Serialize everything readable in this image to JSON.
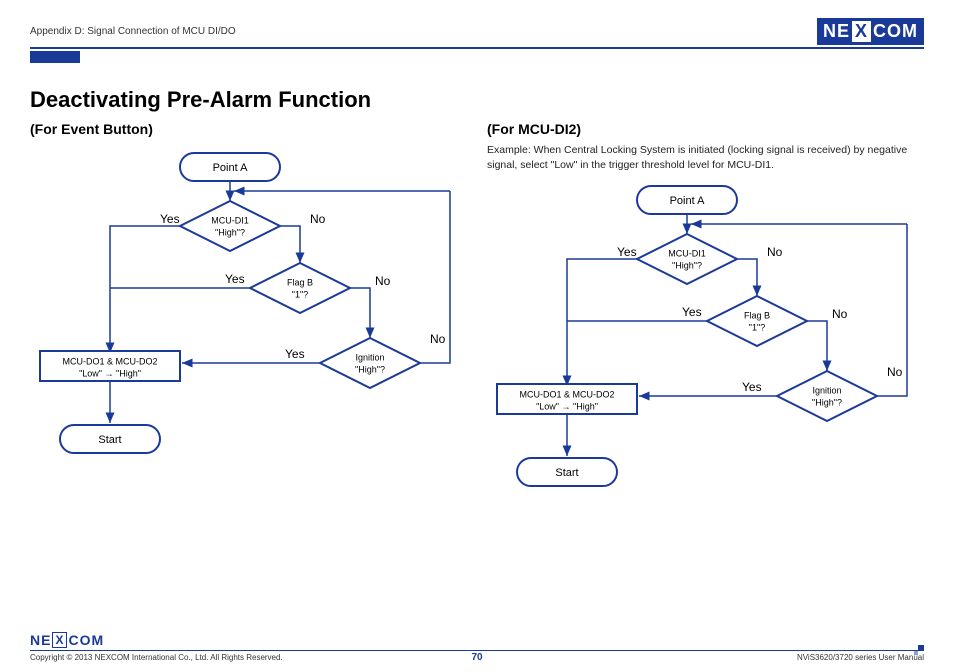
{
  "header": {
    "appendix": "Appendix D: Signal Connection of MCU DI/DO",
    "logo_left": "NE",
    "logo_mid": "X",
    "logo_right": "COM"
  },
  "title": "Deactivating Pre-Alarm Function",
  "left": {
    "subhead": "(For Event Button)",
    "nodes": {
      "pointA": "Point A",
      "di1_l1": "MCU-DI1",
      "di1_l2": "\"High\"?",
      "flag_l1": "Flag B",
      "flag_l2": "\"1\"?",
      "ign_l1": "Ignition",
      "ign_l2": "\"High\"?",
      "do_l1": "MCU-DO1 & MCU-DO2",
      "do_l2": "\"Low\" → \"High\"",
      "start": "Start"
    },
    "labels": {
      "yes1": "Yes",
      "no1": "No",
      "yes2": "Yes",
      "no2": "No",
      "yes3": "Yes",
      "no3": "No"
    }
  },
  "right": {
    "subhead": "(For MCU-DI2)",
    "example": "Example: When Central Locking System is initiated (locking signal is received) by negative signal, select \"Low\" in the trigger threshold level for MCU-DI1.",
    "nodes": {
      "pointA": "Point A",
      "di1_l1": "MCU-DI1",
      "di1_l2": "\"High\"?",
      "flag_l1": "Flag B",
      "flag_l2": "\"1\"?",
      "ign_l1": "Ignition",
      "ign_l2": "\"High\"?",
      "do_l1": "MCU-DO1 & MCU-DO2",
      "do_l2": "\"Low\" → \"High\"",
      "start": "Start"
    },
    "labels": {
      "yes1": "Yes",
      "no1": "No",
      "yes2": "Yes",
      "no2": "No",
      "yes3": "Yes",
      "no3": "No"
    }
  },
  "footer": {
    "copyright": "Copyright © 2013 NEXCOM International Co., Ltd. All Rights Reserved.",
    "page": "70",
    "doc": "NViS3620/3720 series User Manual"
  },
  "chart_data": [
    {
      "type": "flowchart",
      "title": "Deactivating Pre-Alarm Function (For Event Button)",
      "nodes": [
        {
          "id": "pointA",
          "shape": "terminator",
          "text": "Point A"
        },
        {
          "id": "d1",
          "shape": "decision",
          "text": "MCU-DI1 \"High\"?"
        },
        {
          "id": "d2",
          "shape": "decision",
          "text": "Flag B \"1\"?"
        },
        {
          "id": "d3",
          "shape": "decision",
          "text": "Ignition \"High\"?"
        },
        {
          "id": "p1",
          "shape": "process",
          "text": "MCU-DO1 & MCU-DO2 \"Low\" → \"High\""
        },
        {
          "id": "start",
          "shape": "terminator",
          "text": "Start"
        }
      ],
      "edges": [
        {
          "from": "pointA",
          "to": "d1"
        },
        {
          "from": "d1",
          "to": "p1",
          "label": "Yes"
        },
        {
          "from": "d1",
          "to": "d2",
          "label": "No"
        },
        {
          "from": "d2",
          "to": "p1",
          "label": "Yes"
        },
        {
          "from": "d2",
          "to": "d3",
          "label": "No"
        },
        {
          "from": "d3",
          "to": "p1",
          "label": "Yes"
        },
        {
          "from": "d3",
          "to": "pointA",
          "label": "No"
        },
        {
          "from": "p1",
          "to": "start"
        }
      ]
    },
    {
      "type": "flowchart",
      "title": "Deactivating Pre-Alarm Function (For MCU-DI2)",
      "note": "Example: When Central Locking System is initiated (locking signal is received) by negative signal, select \"Low\" in the trigger threshold level for MCU-DI1.",
      "nodes": [
        {
          "id": "pointA",
          "shape": "terminator",
          "text": "Point A"
        },
        {
          "id": "d1",
          "shape": "decision",
          "text": "MCU-DI1 \"High\"?"
        },
        {
          "id": "d2",
          "shape": "decision",
          "text": "Flag B \"1\"?"
        },
        {
          "id": "d3",
          "shape": "decision",
          "text": "Ignition \"High\"?"
        },
        {
          "id": "p1",
          "shape": "process",
          "text": "MCU-DO1 & MCU-DO2 \"Low\" → \"High\""
        },
        {
          "id": "start",
          "shape": "terminator",
          "text": "Start"
        }
      ],
      "edges": [
        {
          "from": "pointA",
          "to": "d1"
        },
        {
          "from": "d1",
          "to": "p1",
          "label": "Yes"
        },
        {
          "from": "d1",
          "to": "d2",
          "label": "No"
        },
        {
          "from": "d2",
          "to": "p1",
          "label": "Yes"
        },
        {
          "from": "d2",
          "to": "d3",
          "label": "No"
        },
        {
          "from": "d3",
          "to": "p1",
          "label": "Yes"
        },
        {
          "from": "d3",
          "to": "pointA",
          "label": "No"
        },
        {
          "from": "p1",
          "to": "start"
        }
      ]
    }
  ]
}
